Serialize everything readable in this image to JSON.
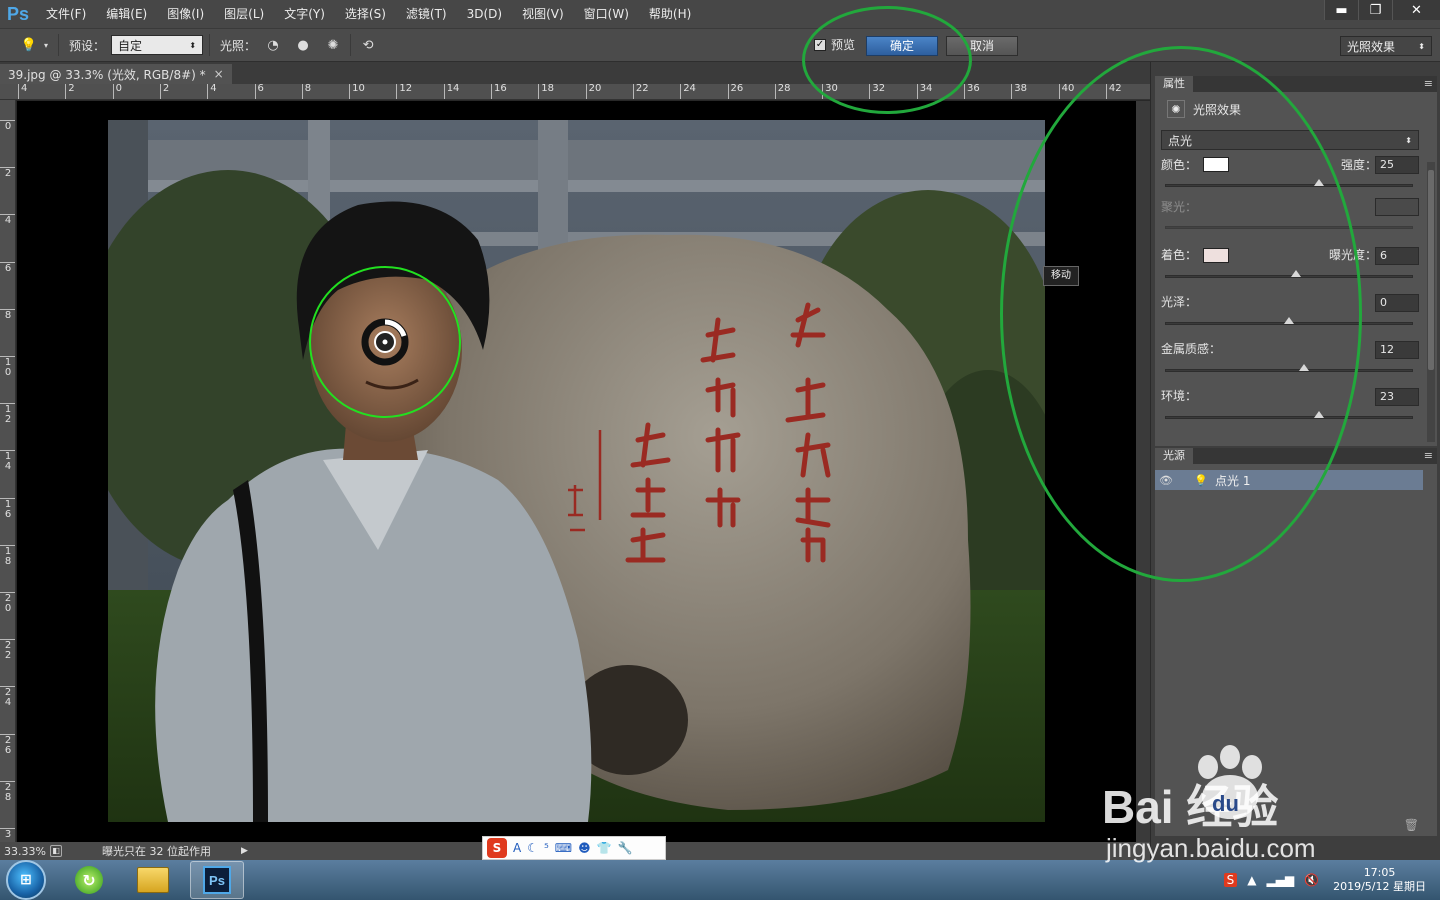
{
  "app": {
    "logo": "Ps"
  },
  "menu": [
    "文件(F)",
    "编辑(E)",
    "图像(I)",
    "图层(L)",
    "文字(Y)",
    "选择(S)",
    "滤镜(T)",
    "3D(D)",
    "视图(V)",
    "窗口(W)",
    "帮助(H)"
  ],
  "window_controls": {
    "minimize": "▬",
    "restore": "❐",
    "close": "✕"
  },
  "options": {
    "preset_label": "预设：",
    "preset_value": "自定",
    "lights_label": "光照：",
    "preview_label": "预览",
    "preview_checked": true,
    "ok_label": "确定",
    "cancel_label": "取消",
    "workspace_value": "光照效果"
  },
  "document": {
    "tab_title": "39.jpg @ 33.3% (光效, RGB/8#) *",
    "close_glyph": "×",
    "ruler_h": [
      "4",
      "2",
      "0",
      "2",
      "4",
      "6",
      "8",
      "10",
      "12",
      "14",
      "16",
      "18",
      "20",
      "22",
      "24",
      "26",
      "28",
      "30",
      "32",
      "34",
      "36",
      "38",
      "40",
      "42"
    ],
    "ruler_v": [
      "0",
      "2",
      "4",
      "6",
      "8",
      "1\n0",
      "1\n2",
      "1\n4",
      "1\n6",
      "1\n8",
      "2\n0",
      "2\n2",
      "2\n4",
      "2\n6",
      "2\n8",
      "3"
    ]
  },
  "status": {
    "zoom": "33.33%",
    "message": "曝光只在 32 位起作用"
  },
  "tooltip": "移动",
  "properties": {
    "tab": "属性",
    "title": "光照效果",
    "light_type": "点光",
    "color_label": "颜色：",
    "color_hex": "#ffffff",
    "intensity_label": "强度：",
    "intensity": "25",
    "intensity_pct": 62,
    "hotspot_label": "聚光：",
    "colorize_label": "着色：",
    "colorize_hex": "#eee0de",
    "exposure_label": "曝光度：",
    "exposure": "6",
    "exposure_pct": 53,
    "gloss_label": "光泽：",
    "gloss": "0",
    "gloss_pct": 50,
    "metallic_label": "金属质感：",
    "metallic": "12",
    "metallic_pct": 56,
    "ambience_label": "环境：",
    "ambience": "23",
    "ambience_pct": 62
  },
  "lights_panel": {
    "tab": "光源",
    "items": [
      {
        "name": "点光 1"
      }
    ]
  },
  "ime": {
    "logo": "S",
    "items": [
      "A",
      "☾",
      "⁵",
      "⌨",
      "☻",
      "👕",
      "🔧"
    ]
  },
  "taskbar": {
    "clock_time": "17:05",
    "clock_date": "2019/5/12 星期日"
  },
  "watermark": {
    "brand": "Bai 经验",
    "du": "du",
    "url": "jingyan.baidu.com"
  },
  "colors": {
    "accent": "#2d5f9e",
    "annotation": "#22a83c"
  }
}
